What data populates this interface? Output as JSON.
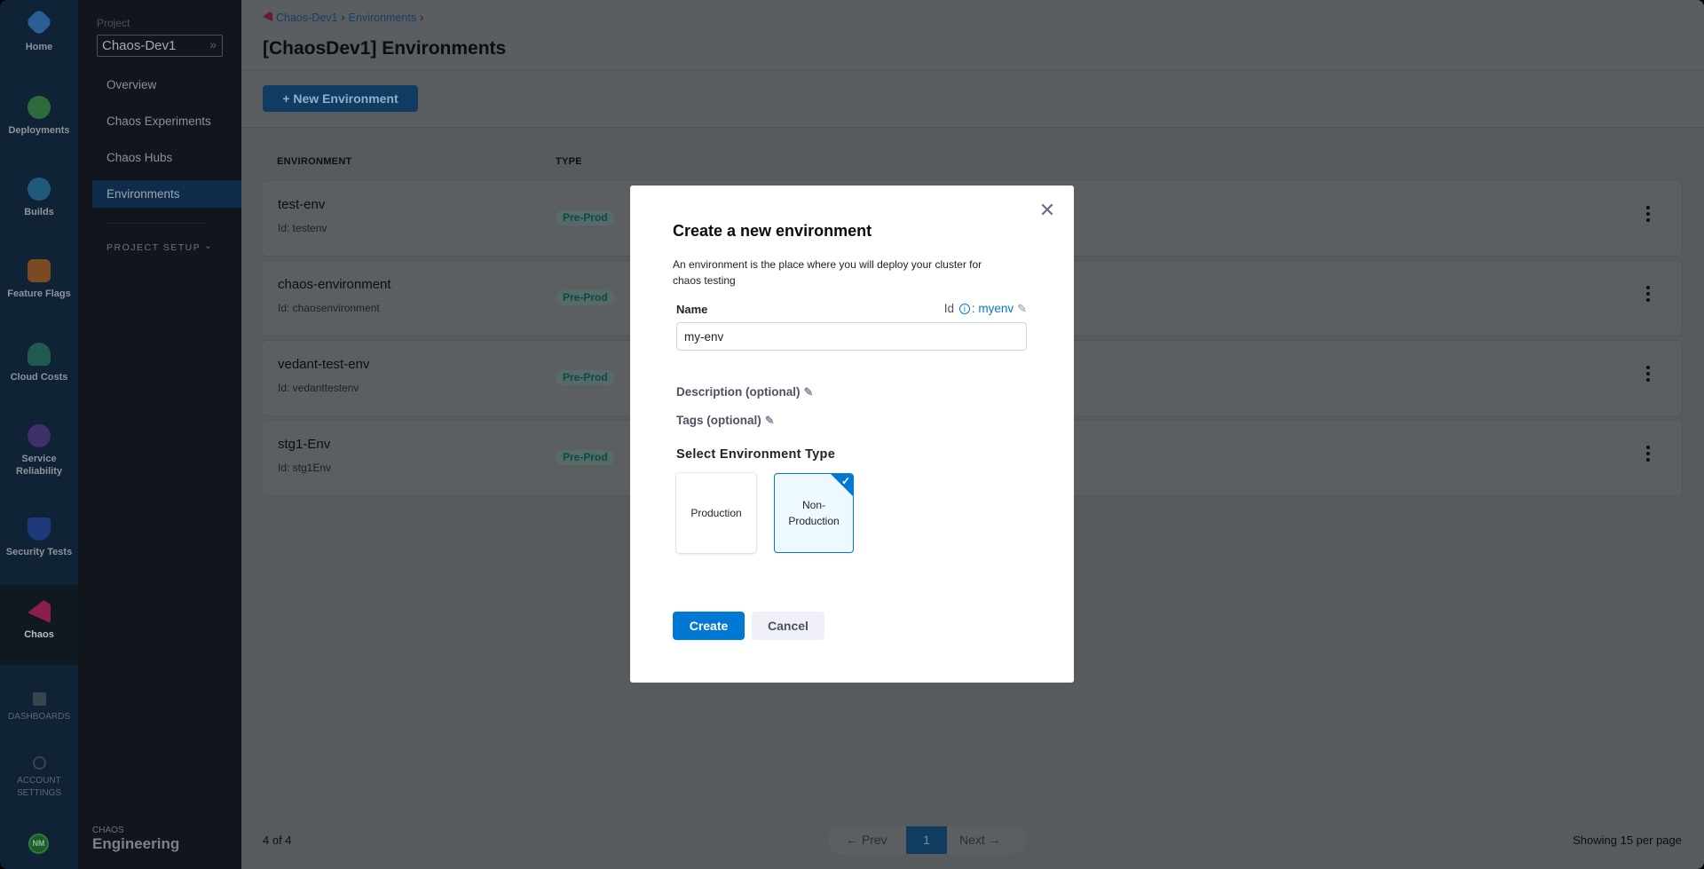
{
  "rail": {
    "items": [
      {
        "label": "Home",
        "icon": "home-icon",
        "color": "#2a5f96"
      },
      {
        "label": "Deployments",
        "icon": "deployments-icon",
        "color": "#2f6b3a"
      },
      {
        "label": "Builds",
        "icon": "builds-icon",
        "color": "#1f5a7a"
      },
      {
        "label": "Feature Flags",
        "icon": "feature-flags-icon",
        "color": "#7a4a20"
      },
      {
        "label": "Cloud Costs",
        "icon": "cloud-costs-icon",
        "color": "#1e5a50"
      },
      {
        "label": "Service Reliability",
        "icon": "service-reliability-icon",
        "color": "#40306a"
      },
      {
        "label": "Security Tests",
        "icon": "security-tests-icon",
        "color": "#1f3a7a"
      },
      {
        "label": "Chaos",
        "icon": "chaos-icon",
        "color": "#8a1f4a"
      },
      {
        "label": "DASHBOARDS",
        "icon": "dashboards-icon"
      },
      {
        "label": "ACCOUNT SETTINGS",
        "icon": "gear-icon"
      }
    ],
    "avatar": "NM"
  },
  "sidebar": {
    "project_label": "Project",
    "project": "Chaos-Dev1",
    "items": [
      "Overview",
      "Chaos Experiments",
      "Chaos Hubs",
      "Environments"
    ],
    "active": "Environments",
    "project_setup": "PROJECT SETUP",
    "brand_top": "CHAOS",
    "brand_bottom": "Engineering"
  },
  "header": {
    "breadcrumb": [
      "Chaos-Dev1",
      "Environments"
    ],
    "title": "[ChaosDev1] Environments",
    "new_button": "+ New Environment"
  },
  "table": {
    "columns": [
      "ENVIRONMENT",
      "TYPE"
    ],
    "rows": [
      {
        "name": "test-env",
        "id": "Id: testenv",
        "type": "Pre-Prod"
      },
      {
        "name": "chaos-environment",
        "id": "Id: chaosenvironment",
        "type": "Pre-Prod"
      },
      {
        "name": "vedant-test-env",
        "id": "Id: vedanttestenv",
        "type": "Pre-Prod"
      },
      {
        "name": "stg1-Env",
        "id": "Id: stg1Env",
        "type": "Pre-Prod"
      }
    ]
  },
  "footer": {
    "count": "4 of 4",
    "prev": "← Prev",
    "page": "1",
    "next": "Next →",
    "showing": "Showing 15 per page"
  },
  "modal": {
    "title": "Create a new environment",
    "description": "An environment is the place where you will deploy your cluster for chaos testing",
    "name_label": "Name",
    "id_label": "Id",
    "id_value": "myenv",
    "name_value": "my-env",
    "description_label": "Description (optional)",
    "tags_label": "Tags (optional)",
    "type_label": "Select Environment Type",
    "types": [
      "Production",
      "Non-Production"
    ],
    "selected_type": "Non-Production",
    "create": "Create",
    "cancel": "Cancel"
  },
  "colors": {
    "accent": "#0278d5",
    "badge": "#0a8f8a"
  }
}
